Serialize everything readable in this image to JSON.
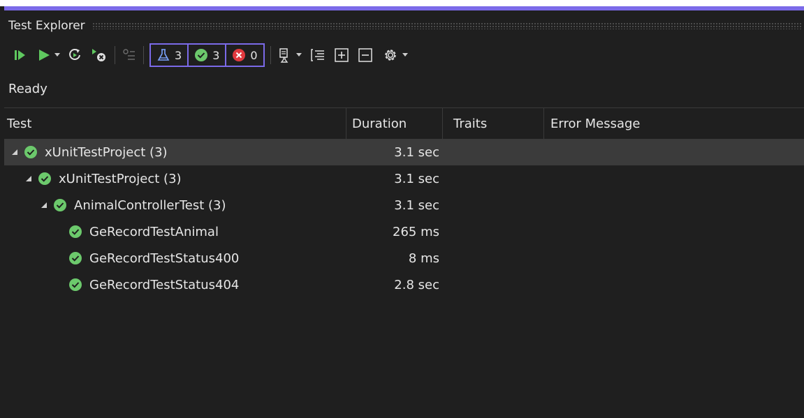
{
  "window": {
    "title": "Test Explorer"
  },
  "toolbar": {
    "run_all": "run-all-icon",
    "run": "run-icon",
    "repeat_last": "repeat-icon",
    "cancel": "cancel-icon",
    "filter": "filter-icon",
    "counters": {
      "total": "3",
      "passed": "3",
      "failed": "0"
    },
    "playlist": "playlist-icon",
    "group_by": "group-icon",
    "expand_all": "expand-all-icon",
    "collapse_all": "collapse-all-icon",
    "settings": "gear-icon"
  },
  "status": {
    "text": "Ready"
  },
  "columns": {
    "test": "Test",
    "duration": "Duration",
    "traits": "Traits",
    "error": "Error Message"
  },
  "rows": [
    {
      "name": "xUnitTestProject (3)",
      "duration": "3.1 sec"
    },
    {
      "name": "xUnitTestProject (3)",
      "duration": "3.1 sec"
    },
    {
      "name": "AnimalControllerTest (3)",
      "duration": "3.1 sec"
    },
    {
      "name": "GeRecordTestAnimal",
      "duration": "265 ms"
    },
    {
      "name": "GeRecordTestStatus400",
      "duration": "8 ms"
    },
    {
      "name": "GeRecordTestStatus404",
      "duration": "2.8 sec"
    }
  ],
  "colors": {
    "accent": "#7b6ae8",
    "pass": "#6cc96c",
    "fail": "#e0393e",
    "run": "#5fc85f"
  }
}
